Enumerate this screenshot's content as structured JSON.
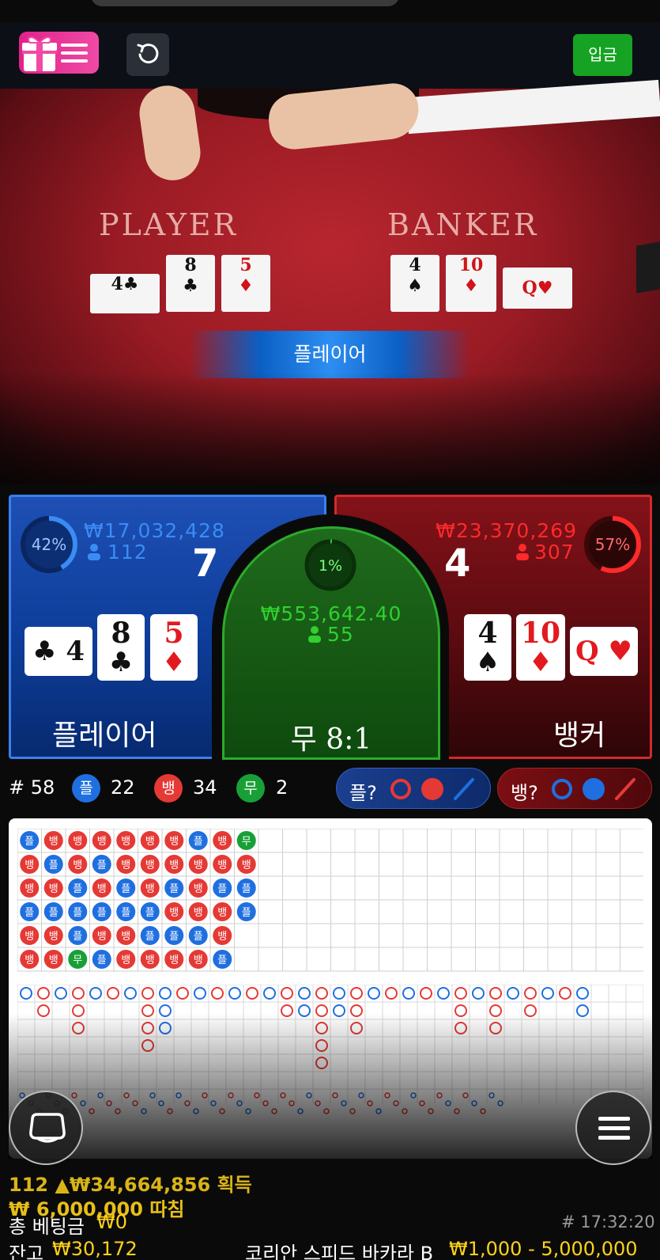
{
  "header": {
    "deposit_label": "입금",
    "gift_icon": "gift-icon",
    "menu_icon": "hamburger-icon",
    "refresh_icon": "refresh-icon"
  },
  "video": {
    "player_label": "PLAYER",
    "banker_label": "BANKER",
    "result": "플레이어",
    "player_cards": [
      {
        "rank": "4",
        "suit": "♣",
        "color": "black"
      },
      {
        "rank": "8",
        "suit": "♣",
        "color": "black"
      },
      {
        "rank": "5",
        "suit": "♦",
        "color": "red"
      }
    ],
    "banker_cards": [
      {
        "rank": "4",
        "suit": "♠",
        "color": "black"
      },
      {
        "rank": "10",
        "suit": "♦",
        "color": "red"
      },
      {
        "rank": "Q",
        "suit": "♥",
        "color": "red"
      }
    ]
  },
  "bets": {
    "player": {
      "pct": "42%",
      "pct_value": 0.42,
      "amount": "₩17,032,428",
      "count": "112",
      "score": "7",
      "name": "플레이어",
      "color": "#3a8cf5",
      "cards": [
        {
          "rank": "4",
          "suit": "♣",
          "color": "black",
          "rotated": true
        },
        {
          "rank": "8",
          "suit": "♣",
          "color": "black"
        },
        {
          "rank": "5",
          "suit": "♦",
          "color": "red"
        }
      ]
    },
    "tie": {
      "pct": "1%",
      "pct_value": 0.01,
      "amount": "₩553,642.40",
      "count": "55",
      "name": "무 8:1",
      "color": "#2fd02f"
    },
    "banker": {
      "pct": "57%",
      "pct_value": 0.57,
      "amount": "₩23,370,269",
      "count": "307",
      "score": "4",
      "name": "뱅커",
      "color": "#ff2a2a",
      "cards": [
        {
          "rank": "4",
          "suit": "♠",
          "color": "black"
        },
        {
          "rank": "10",
          "suit": "♦",
          "color": "red"
        },
        {
          "rank": "Q",
          "suit": "♥",
          "color": "red",
          "rotated": true
        }
      ]
    }
  },
  "stats": {
    "round": "# 58",
    "player_badge": "플",
    "player_count": "22",
    "banker_badge": "뱅",
    "banker_count": "34",
    "tie_badge": "무",
    "tie_count": "2"
  },
  "ask": {
    "player_label": "플?",
    "banker_label": "뱅?",
    "player_colors": [
      "#e53935",
      "#e53935",
      "#1f6fe0"
    ],
    "banker_colors": [
      "#1f6fe0",
      "#1f6fe0",
      "#e53935"
    ]
  },
  "bead_road": [
    [
      "P",
      "B",
      "B",
      "B",
      "B",
      "B",
      "B",
      "P",
      "B",
      "T"
    ],
    [
      "B",
      "P",
      "B",
      "P",
      "B",
      "B",
      "B",
      "B",
      "B",
      "B"
    ],
    [
      "B",
      "B",
      "P",
      "B",
      "P",
      "B",
      "P",
      "B",
      "P",
      "P"
    ],
    [
      "P",
      "P",
      "P",
      "P",
      "P",
      "P",
      "B",
      "B",
      "B",
      "P"
    ],
    [
      "B",
      "B",
      "P",
      "B",
      "B",
      "P",
      "P",
      "P",
      "B",
      ""
    ],
    [
      "B",
      "B",
      "T",
      "P",
      "B",
      "B",
      "B",
      "B",
      "P",
      ""
    ]
  ],
  "ghost_text": {
    "line1": "112 ▲₩34,664,856 획득",
    "line2": "₩ 6,000,000 따침"
  },
  "footer": {
    "total_bet_label": "총 베팅금",
    "total_bet_value": "₩0",
    "time": "# 17:32:20",
    "balance_label": "잔고",
    "balance_value": "₩30,172",
    "table_name": "코리안 스피드 바카라 B",
    "limits": "₩1,000 - 5,000,000"
  }
}
